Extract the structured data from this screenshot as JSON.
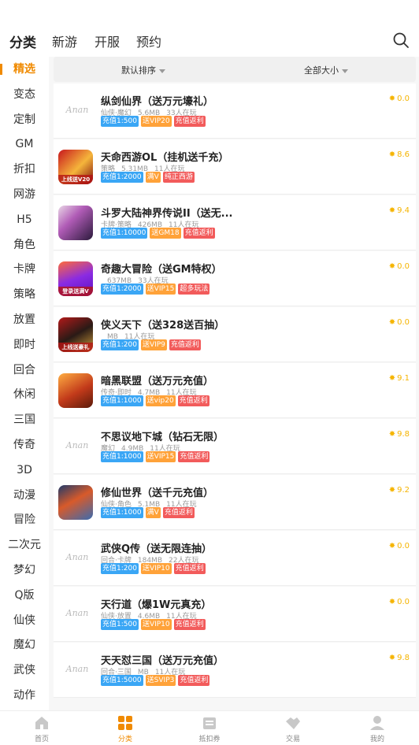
{
  "top_tabs": [
    "分类",
    "新游",
    "开服",
    "预约"
  ],
  "sidebar": [
    "精选",
    "变态",
    "定制",
    "GM",
    "折扣",
    "网游",
    "H5",
    "角色",
    "卡牌",
    "策略",
    "放置",
    "即时",
    "回合",
    "休闲",
    "三国",
    "传奇",
    "3D",
    "动漫",
    "冒险",
    "二次元",
    "梦幻",
    "Q版",
    "仙侠",
    "魔幻",
    "武侠",
    "动作"
  ],
  "filters": {
    "sort": "默认排序",
    "size": "全部大小"
  },
  "games": [
    {
      "title": "纵剑仙界（送万元壕礼）",
      "genre": "仙侠·魔幻",
      "size": "5.6MB",
      "players": "33人在玩",
      "score": "0.0",
      "tags": [
        [
          "充值1:500",
          "blue"
        ],
        [
          "送VIP20",
          "orange"
        ],
        [
          "充值返利",
          "red"
        ]
      ],
      "thumb": "placeholder",
      "thumb_text": "",
      "banner": ""
    },
    {
      "title": "天命西游OL（挂机送千充）",
      "genre": "策略",
      "size": "5.31MB",
      "players": "11人在玩",
      "score": "8.6",
      "tags": [
        [
          "充值1:2000",
          "blue"
        ],
        [
          "满V",
          "orange"
        ],
        [
          "纯正西游",
          "red"
        ]
      ],
      "thumb": "art1",
      "thumb_text": "",
      "banner": "上线送V20"
    },
    {
      "title": "斗罗大陆神界传说II（送无...",
      "genre": "卡牌·策略",
      "size": "426MB",
      "players": "11人在玩",
      "score": "9.4",
      "tags": [
        [
          "充值1:10000",
          "blue"
        ],
        [
          "送GM18",
          "orange"
        ],
        [
          "充值返利",
          "red"
        ]
      ],
      "thumb": "art2",
      "thumb_text": "",
      "banner": ""
    },
    {
      "title": "奇趣大冒险（送GM特权）",
      "genre": "",
      "size": "637MB",
      "players": "33人在玩",
      "score": "0.0",
      "tags": [
        [
          "充值1:2000",
          "blue"
        ],
        [
          "送VIP15",
          "orange"
        ],
        [
          "超多玩法",
          "red"
        ]
      ],
      "thumb": "art3",
      "thumb_text": "",
      "banner": "登录送满V"
    },
    {
      "title": "侠义天下（送328送百抽）",
      "genre": "",
      "size": "MB",
      "players": "11人在玩",
      "score": "0.0",
      "tags": [
        [
          "充值1:200",
          "blue"
        ],
        [
          "送VIP9",
          "orange"
        ],
        [
          "充值返利",
          "red"
        ]
      ],
      "thumb": "art4",
      "thumb_text": "",
      "banner": "上线送豪礼"
    },
    {
      "title": "暗黑联盟（送万元充值）",
      "genre": "传奇·即时",
      "size": "4.7MB",
      "players": "11人在玩",
      "score": "9.1",
      "tags": [
        [
          "充值1:1000",
          "blue"
        ],
        [
          "送vip20",
          "orange"
        ],
        [
          "充值返利",
          "red"
        ]
      ],
      "thumb": "art5",
      "thumb_text": "",
      "banner": ""
    },
    {
      "title": "不思议地下城（钻石无限）",
      "genre": "魔幻",
      "size": "4.9MB",
      "players": "11人在玩",
      "score": "9.8",
      "tags": [
        [
          "充值1:1000",
          "blue"
        ],
        [
          "送VIP15",
          "orange"
        ],
        [
          "充值返利",
          "red"
        ]
      ],
      "thumb": "placeholder",
      "thumb_text": "",
      "banner": ""
    },
    {
      "title": "修仙世界（送千元充值）",
      "genre": "仙侠·角色",
      "size": "5.1MB",
      "players": "11人在玩",
      "score": "9.2",
      "tags": [
        [
          "充值1:1000",
          "blue"
        ],
        [
          "满V",
          "orange"
        ],
        [
          "充值返利",
          "red"
        ]
      ],
      "thumb": "art6",
      "thumb_text": "",
      "banner": ""
    },
    {
      "title": "武侠Q传（送无限连抽）",
      "genre": "回合·卡牌",
      "size": "184MB",
      "players": "22人在玩",
      "score": "0.0",
      "tags": [
        [
          "充值1:200",
          "blue"
        ],
        [
          "送VIP10",
          "orange"
        ],
        [
          "充值返利",
          "red"
        ]
      ],
      "thumb": "placeholder",
      "thumb_text": "",
      "banner": ""
    },
    {
      "title": "天行道（爆1W元真充）",
      "genre": "仙侠·放置",
      "size": "4.6MB",
      "players": "11人在玩",
      "score": "0.0",
      "tags": [
        [
          "充值1:500",
          "blue"
        ],
        [
          "送VIP10",
          "orange"
        ],
        [
          "充值返利",
          "red"
        ]
      ],
      "thumb": "placeholder",
      "thumb_text": "",
      "banner": ""
    },
    {
      "title": "天天怼三国（送万元充值）",
      "genre": "回合·三国",
      "size": "MB",
      "players": "11人在玩",
      "score": "9.8",
      "tags": [
        [
          "充值1:5000",
          "blue"
        ],
        [
          "送SVIP3",
          "orange"
        ],
        [
          "充值返利",
          "red"
        ]
      ],
      "thumb": "placeholder",
      "thumb_text": "",
      "banner": ""
    }
  ],
  "bottom_nav": [
    "首页",
    "分类",
    "抵扣券",
    "交易",
    "我的"
  ],
  "colors": {
    "accent": "#f08a00",
    "score": "#f5b400",
    "tag_blue": "#3aa6f5",
    "tag_orange": "#ffa239",
    "tag_red": "#f25b5b"
  }
}
